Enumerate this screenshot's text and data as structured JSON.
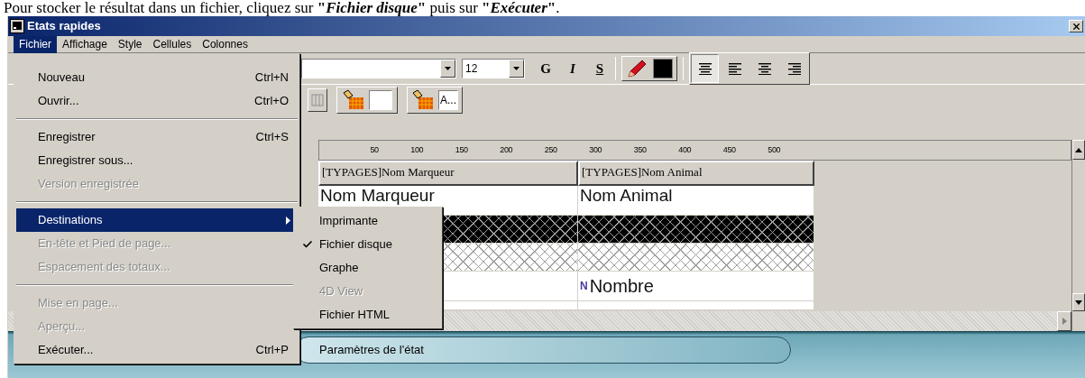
{
  "caption": "Pour stocker le résultat dans un fichier, cliquez sur **\"*Fichier disque*\"** puis sur **\"*Exécuter*\"**.",
  "window": {
    "title": "Etats rapides"
  },
  "menu_bar": [
    {
      "label": "Fichier",
      "selected": true
    },
    {
      "label": "Affichage",
      "selected": false
    },
    {
      "label": "Style",
      "selected": false
    },
    {
      "label": "Cellules",
      "selected": false
    },
    {
      "label": "Colonnes",
      "selected": false
    }
  ],
  "file_menu": [
    {
      "kind": "item",
      "label": "Nouveau",
      "shortcut": "Ctrl+N",
      "disabled": false,
      "highlighted": false
    },
    {
      "kind": "item",
      "label": "Ouvrir...",
      "shortcut": "Ctrl+O",
      "disabled": false,
      "highlighted": false
    },
    {
      "kind": "separator"
    },
    {
      "kind": "item",
      "label": "Enregistrer",
      "shortcut": "Ctrl+S",
      "disabled": false,
      "highlighted": false
    },
    {
      "kind": "item",
      "label": "Enregistrer sous...",
      "disabled": false,
      "highlighted": false
    },
    {
      "kind": "item",
      "label": "Version enregistrée",
      "disabled": true,
      "highlighted": false
    },
    {
      "kind": "separator"
    },
    {
      "kind": "submenu",
      "label": "Destinations",
      "disabled": false,
      "highlighted": true
    },
    {
      "kind": "item",
      "label": "En-tête et Pied de page...",
      "disabled": true,
      "highlighted": false
    },
    {
      "kind": "item",
      "label": "Espacement des totaux...",
      "disabled": true,
      "highlighted": false
    },
    {
      "kind": "separator"
    },
    {
      "kind": "item",
      "label": "Mise en page...",
      "disabled": true,
      "highlighted": false
    },
    {
      "kind": "item",
      "label": "Aperçu...",
      "disabled": true,
      "highlighted": false
    },
    {
      "kind": "item",
      "label": "Exécuter...",
      "shortcut": "Ctrl+P",
      "disabled": false,
      "highlighted": false
    }
  ],
  "destinations_menu": [
    {
      "label": "Imprimante",
      "checked": false,
      "disabled": false
    },
    {
      "label": "Fichier disque",
      "checked": true,
      "disabled": false
    },
    {
      "label": "Graphe",
      "checked": false,
      "disabled": false
    },
    {
      "label": "4D View",
      "checked": false,
      "disabled": true
    },
    {
      "label": "Fichier HTML",
      "checked": false,
      "disabled": false
    }
  ],
  "toolbar": {
    "font_size": "12",
    "style_buttons": [
      {
        "label": "G",
        "kind": "bold"
      },
      {
        "label": "I",
        "kind": "italic"
      },
      {
        "label": "S",
        "kind": "underline"
      }
    ],
    "alignments": [
      {
        "kind": "justify",
        "selected": true
      },
      {
        "kind": "left",
        "selected": false
      },
      {
        "kind": "center",
        "selected": false
      },
      {
        "kind": "right",
        "selected": false
      }
    ],
    "text_color_button": "A..."
  },
  "ruler": [
    "50",
    "100",
    "150",
    "200",
    "250",
    "300",
    "350",
    "400",
    "450",
    "500"
  ],
  "grid": {
    "columns": [
      "[TYPAGES]Nom Marqueur",
      "[TYPAGES]Nom Animal"
    ],
    "rows": [
      {
        "kind": "labels",
        "cells": [
          "Nom Marqueur",
          "Nom Animal"
        ]
      },
      {
        "kind": "dark_hatch"
      },
      {
        "kind": "light_hatch"
      },
      {
        "kind": "summary",
        "type_glyph": "N",
        "value": "Nombre"
      },
      {
        "kind": "blank"
      }
    ]
  },
  "bottom_panel": {
    "tab": "Paramètres de l'état"
  }
}
